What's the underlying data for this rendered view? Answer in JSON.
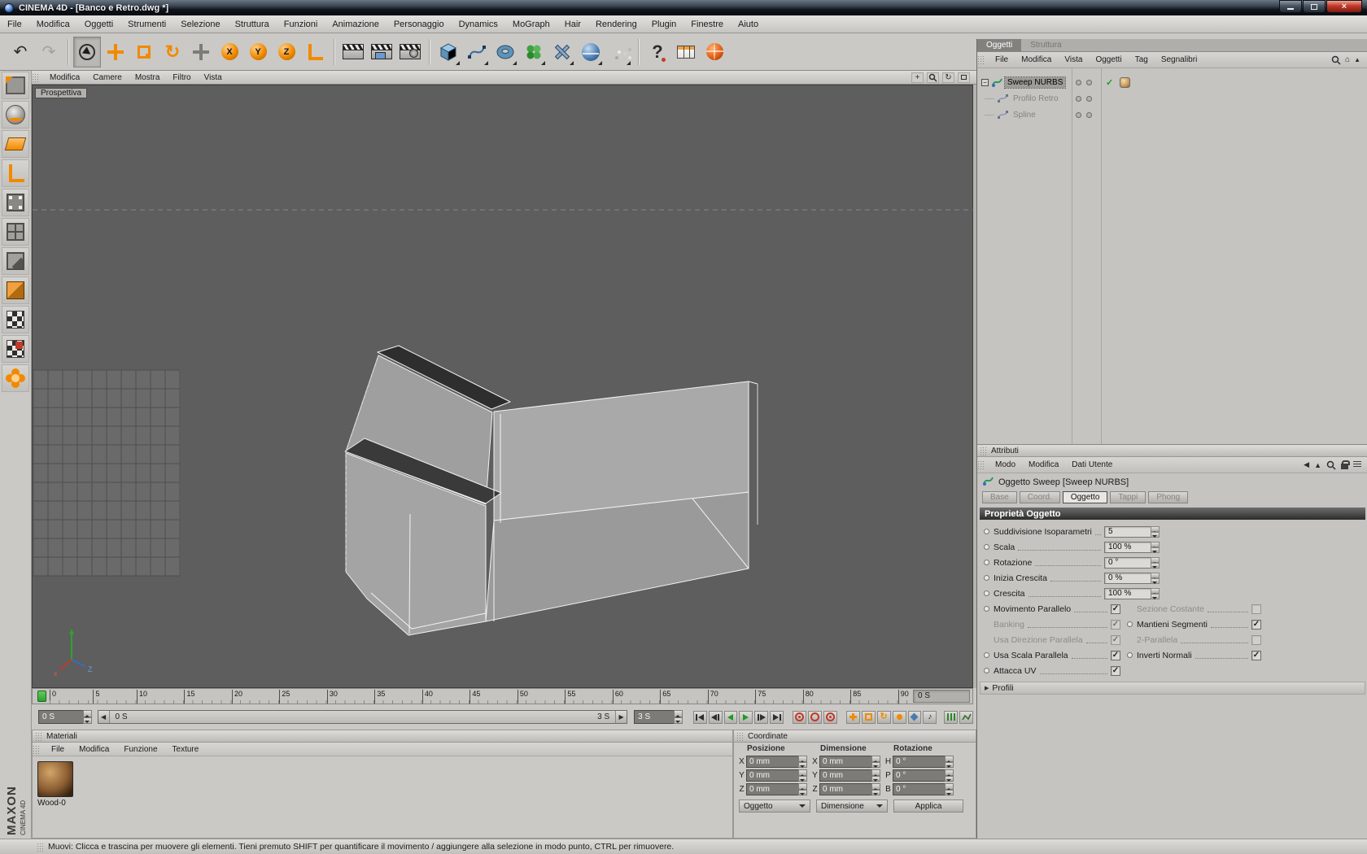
{
  "window": {
    "title": "CINEMA 4D - [Banco e Retro.dwg *]",
    "brand": "MAXON",
    "brand_sub": "CINEMA 4D"
  },
  "menubar": [
    "File",
    "Modifica",
    "Oggetti",
    "Strumenti",
    "Selezione",
    "Struttura",
    "Funzioni",
    "Animazione",
    "Personaggio",
    "Dynamics",
    "MoGraph",
    "Hair",
    "Rendering",
    "Plugin",
    "Finestre",
    "Aiuto"
  ],
  "toolbar": {
    "axis_locks": [
      "X",
      "Y",
      "Z"
    ]
  },
  "viewport": {
    "label": "Prospettiva",
    "menu": [
      "Modifica",
      "Camere",
      "Mostra",
      "Filtro",
      "Vista"
    ],
    "axis_x_label": "x",
    "axis_z_label": "Z"
  },
  "timeline": {
    "ticks": [
      "0",
      "5",
      "10",
      "15",
      "20",
      "25",
      "30",
      "35",
      "40",
      "45",
      "50",
      "55",
      "60",
      "65",
      "70",
      "75",
      "80",
      "85",
      "90"
    ],
    "current_time_display": "0 S",
    "time_field": "0 S",
    "range_start": "0 S",
    "range_end": "3 S",
    "duration_field": "3 S"
  },
  "materials": {
    "title": "Materiali",
    "menu": [
      "File",
      "Modifica",
      "Funzione",
      "Texture"
    ],
    "items": [
      {
        "name": "Wood-0"
      }
    ]
  },
  "coordinates": {
    "title": "Coordinate",
    "columns": [
      "Posizione",
      "Dimensione",
      "Rotazione"
    ],
    "pos_labels": [
      "X",
      "Y",
      "Z"
    ],
    "dim_labels": [
      "X",
      "Y",
      "Z"
    ],
    "rot_labels": [
      "H",
      "P",
      "B"
    ],
    "pos_values": [
      "0 mm",
      "0 mm",
      "0 mm"
    ],
    "dim_values": [
      "0 mm",
      "0 mm",
      "0 mm"
    ],
    "rot_values": [
      "0 °",
      "0 °",
      "0 °"
    ],
    "buttons": {
      "object": "Oggetto",
      "dimension": "Dimensione",
      "apply": "Applica"
    }
  },
  "object_manager": {
    "tabs": [
      "Oggetti",
      "Struttura"
    ],
    "menu": [
      "File",
      "Modifica",
      "Vista",
      "Oggetti",
      "Tag",
      "Segnalibri"
    ],
    "tree": [
      {
        "label": "Sweep NURBS"
      },
      {
        "label": "Profilo Retro"
      },
      {
        "label": "Spline"
      }
    ]
  },
  "attributes": {
    "title": "Attributi",
    "menu": [
      "Modo",
      "Modifica",
      "Dati Utente"
    ],
    "object_header": "Oggetto Sweep [Sweep NURBS]",
    "tabs": [
      "Base",
      "Coord.",
      "Oggetto",
      "Tappi",
      "Phong"
    ],
    "section_title": "Proprietà Oggetto",
    "fields": [
      {
        "label": "Suddivisione Isoparametri",
        "value": "5"
      },
      {
        "label": "Scala",
        "value": "100 %"
      },
      {
        "label": "Rotazione",
        "value": "0 °"
      },
      {
        "label": "Inizia Crescita",
        "value": "0 %"
      },
      {
        "label": "Crescita",
        "value": "100 %"
      }
    ],
    "toggles": {
      "movimento_parallelo": {
        "label": "Movimento Parallelo",
        "checked": true
      },
      "sezione_costante": {
        "label": "Sezione Costante",
        "checked": false
      },
      "banking": {
        "label": "Banking",
        "checked": true
      },
      "mantieni_segmenti": {
        "label": "Mantieni Segmenti",
        "checked": true
      },
      "usa_direzione_parallela": {
        "label": "Usa Direzione Parallela",
        "checked": true
      },
      "due_parallela": {
        "label": "2-Parallela",
        "checked": false
      },
      "usa_scala_parallela": {
        "label": "Usa Scala Parallela",
        "checked": true
      },
      "inverti_normali": {
        "label": "Inverti Normali",
        "checked": true
      },
      "attacca_uv": {
        "label": "Attacca UV",
        "checked": true
      }
    },
    "profili_label": "Profili"
  },
  "status": {
    "text": "Muovi: Clicca e trascina per muovere gli elementi. Tieni premuto SHIFT per quantificare il movimento / aggiungere alla selezione in modo punto, CTRL per rimuovere."
  },
  "icons": {
    "undo": "↶",
    "redo": "↷",
    "rotate": "↻",
    "help": "?",
    "home": "⌂",
    "back": "◀",
    "up": "▲",
    "check": "✓",
    "minus": "−",
    "arrow_right": "▶",
    "arrow_left": "◀",
    "note": "♪",
    "close": "×",
    "orbit": "↻",
    "pan": "+"
  },
  "colors": {
    "accent_orange": "#f08a00",
    "viewport_bg": "#5e5e5e",
    "panel_bg": "#cbc9c5",
    "selection_green": "#2da32d",
    "record_red": "#c0392b"
  }
}
